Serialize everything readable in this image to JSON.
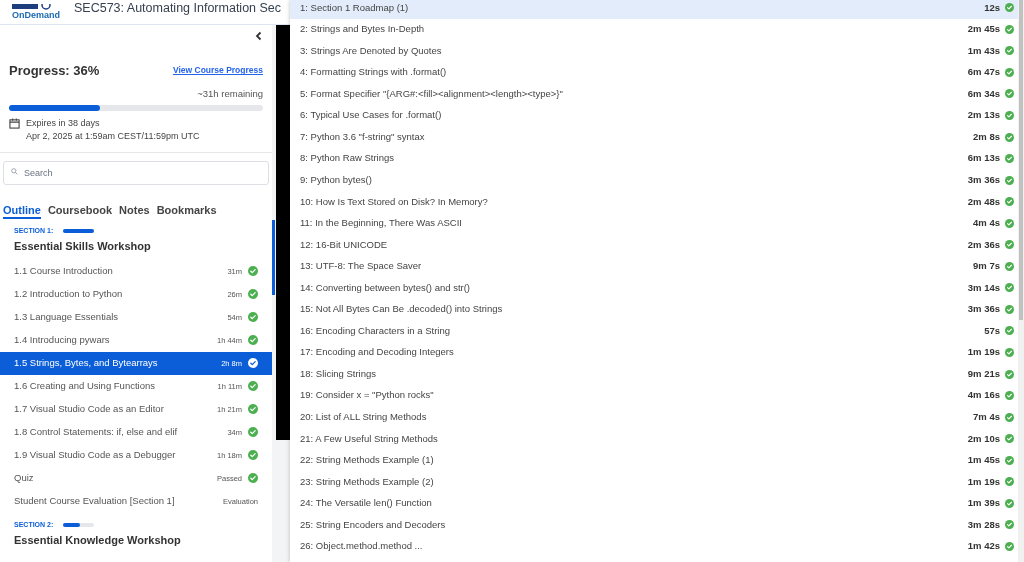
{
  "header": {
    "logo_text": "OnDemand",
    "title": "SEC573: Automating Information Sec"
  },
  "sidebar": {
    "progress": {
      "label": "Progress: 36%",
      "link": "View Course Progress",
      "remaining": "~31h remaining",
      "level": 0.36
    },
    "expiry": {
      "line_1": "Expires in 38 days",
      "line_2": "Apr 2, 2025 at 1:59am CEST/11:59pm UTC"
    },
    "search": {
      "placeholder": "Search"
    },
    "tabs": [
      {
        "label": "Outline",
        "selected": true
      },
      {
        "label": "Coursebook",
        "selected": false
      },
      {
        "label": "Notes",
        "selected": false
      },
      {
        "label": "Bookmarks",
        "selected": false
      }
    ],
    "sections": [
      {
        "label": "SECTION 1:",
        "level": 1.0,
        "title": "Essential Skills Workshop",
        "items": [
          {
            "title": "1.1 Course Introduction",
            "duration": "31m",
            "completed": true,
            "selected": false
          },
          {
            "title": "1.2 Introduction to Python",
            "duration": "26m",
            "completed": true,
            "selected": false
          },
          {
            "title": "1.3 Language Essentials",
            "duration": "54m",
            "completed": true,
            "selected": false
          },
          {
            "title": "1.4 Introducing pywars",
            "duration": "1h 44m",
            "completed": true,
            "selected": false
          },
          {
            "title": "1.5 Strings, Bytes, and Bytearrays",
            "duration": "2h 8m",
            "completed": true,
            "selected": true
          },
          {
            "title": "1.6 Creating and Using Functions",
            "duration": "1h 11m",
            "completed": true,
            "selected": false
          },
          {
            "title": "1.7 Visual Studio Code as an Editor",
            "duration": "1h 21m",
            "completed": true,
            "selected": false
          },
          {
            "title": "1.8 Control Statements: if, else and elif",
            "duration": "34m",
            "completed": true,
            "selected": false
          },
          {
            "title": "1.9 Visual Studio Code as a Debugger",
            "duration": "1h 18m",
            "completed": true,
            "selected": false
          },
          {
            "title": "Quiz",
            "duration": "Passed",
            "completed": true,
            "selected": false
          },
          {
            "title": "Student Course Evaluation [Section 1]",
            "duration": "Evaluation",
            "completed": false,
            "selected": false
          }
        ]
      },
      {
        "label": "SECTION 2:",
        "level": 0.55,
        "title": "Essential Knowledge Workshop"
      }
    ]
  },
  "chapters": [
    {
      "title": "1: Section 1 Roadmap (1)",
      "duration": "12s",
      "completed": true,
      "selected": true
    },
    {
      "title": "2: Strings and Bytes In-Depth",
      "duration": "2m 45s",
      "completed": true,
      "selected": false
    },
    {
      "title": "3: Strings Are Denoted by Quotes",
      "duration": "1m 43s",
      "completed": true,
      "selected": false
    },
    {
      "title": "4: Formatting Strings with .format()",
      "duration": "6m 47s",
      "completed": true,
      "selected": false
    },
    {
      "title": "5: Format Specifier \"{ARG#:<fill><alignment><length><type>}\"",
      "duration": "6m 34s",
      "completed": true,
      "selected": false
    },
    {
      "title": "6: Typical Use Cases for .format()",
      "duration": "2m 13s",
      "completed": true,
      "selected": false
    },
    {
      "title": "7: Python 3.6 \"f-string\" syntax",
      "duration": "2m 8s",
      "completed": true,
      "selected": false
    },
    {
      "title": "8: Python Raw Strings",
      "duration": "6m 13s",
      "completed": true,
      "selected": false
    },
    {
      "title": "9: Python bytes()",
      "duration": "3m 36s",
      "completed": true,
      "selected": false
    },
    {
      "title": "10: How Is Text Stored on Disk? In Memory?",
      "duration": "2m 48s",
      "completed": true,
      "selected": false
    },
    {
      "title": "11: In the Beginning, There Was ASCII",
      "duration": "4m 4s",
      "completed": true,
      "selected": false
    },
    {
      "title": "12: 16-Bit UNICODE",
      "duration": "2m 36s",
      "completed": true,
      "selected": false
    },
    {
      "title": "13: UTF-8: The Space Saver",
      "duration": "9m 7s",
      "completed": true,
      "selected": false
    },
    {
      "title": "14: Converting between bytes() and str()",
      "duration": "3m 14s",
      "completed": true,
      "selected": false
    },
    {
      "title": "15: Not All Bytes Can Be .decoded() into Strings",
      "duration": "3m 36s",
      "completed": true,
      "selected": false
    },
    {
      "title": "16: Encoding Characters in a String",
      "duration": "57s",
      "completed": true,
      "selected": false
    },
    {
      "title": "17: Encoding and Decoding Integers",
      "duration": "1m 19s",
      "completed": true,
      "selected": false
    },
    {
      "title": "18: Slicing Strings",
      "duration": "9m 21s",
      "completed": true,
      "selected": false
    },
    {
      "title": "19: Consider x = \"Python rocks\"",
      "duration": "4m 16s",
      "completed": true,
      "selected": false
    },
    {
      "title": "20: List of ALL String Methods",
      "duration": "7m 4s",
      "completed": true,
      "selected": false
    },
    {
      "title": "21: A Few Useful String Methods",
      "duration": "2m 10s",
      "completed": true,
      "selected": false
    },
    {
      "title": "22: String Methods Example (1)",
      "duration": "1m 45s",
      "completed": true,
      "selected": false
    },
    {
      "title": "23: String Methods Example (2)",
      "duration": "1m 19s",
      "completed": true,
      "selected": false
    },
    {
      "title": "24: The Versatile len() Function",
      "duration": "1m 39s",
      "completed": true,
      "selected": false
    },
    {
      "title": "25: String Encoders and Decoders",
      "duration": "3m 28s",
      "completed": true,
      "selected": false
    },
    {
      "title": "26: Object.method.method ...",
      "duration": "1m 42s",
      "completed": true,
      "selected": false
    }
  ]
}
